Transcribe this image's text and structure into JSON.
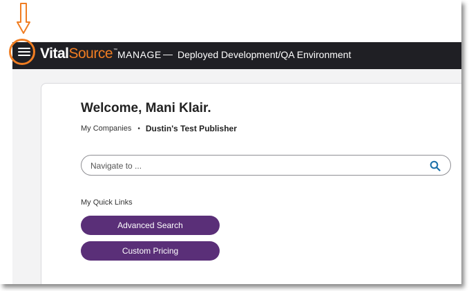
{
  "header": {
    "brand_vital": "Vital",
    "brand_source": "Source",
    "brand_tm": "™",
    "section": "MANAGE",
    "separator": "—",
    "environment": "Deployed Development/QA Environment"
  },
  "main": {
    "welcome": "Welcome, Mani Klair.",
    "breadcrumb": {
      "root": "My Companies",
      "separator": "•",
      "current": "Dustin's Test Publisher"
    },
    "search": {
      "placeholder": "Navigate to ..."
    },
    "quick_links": {
      "title": "My Quick Links",
      "items": [
        {
          "label": "Advanced Search"
        },
        {
          "label": "Custom Pricing"
        }
      ]
    }
  },
  "colors": {
    "topbar": "#1f1f24",
    "accent_orange": "#f07d22",
    "quick_link_purple": "#5a2f78",
    "search_icon_blue": "#1a6fa8"
  },
  "icons": {
    "menu": "hamburger-menu-icon",
    "search": "search-icon",
    "indicator": "down-arrow-icon"
  }
}
